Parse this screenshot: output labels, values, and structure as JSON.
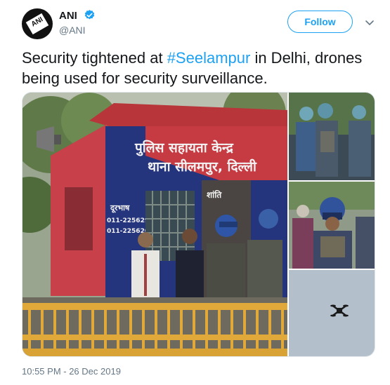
{
  "account": {
    "name": "ANI",
    "handle": "@ANI",
    "avatar_text": "ANI"
  },
  "header": {
    "follow_label": "Follow"
  },
  "tweet": {
    "text_before": "Security tightened at ",
    "hashtag": "#Seelampur",
    "text_after": " in Delhi, drones being used for security surveillance.",
    "timestamp": "10:55 PM - 26 Dec 2019"
  },
  "photo": {
    "sign_line1": "पुलिस सहायता केन्द्र",
    "sign_line2": "थाना सीलमपुर, दिल्ली",
    "phone_label": "दूरभाष",
    "phone1": "011-22562919",
    "phone2": "011-22562035",
    "wall_text": "शांति"
  },
  "colors": {
    "accent": "#1da1f2",
    "muted": "#657786",
    "building_red": "#c4353a",
    "building_blue": "#24337a"
  },
  "icons": {
    "verified": "verified-badge-icon",
    "caret": "chevron-down-icon"
  }
}
